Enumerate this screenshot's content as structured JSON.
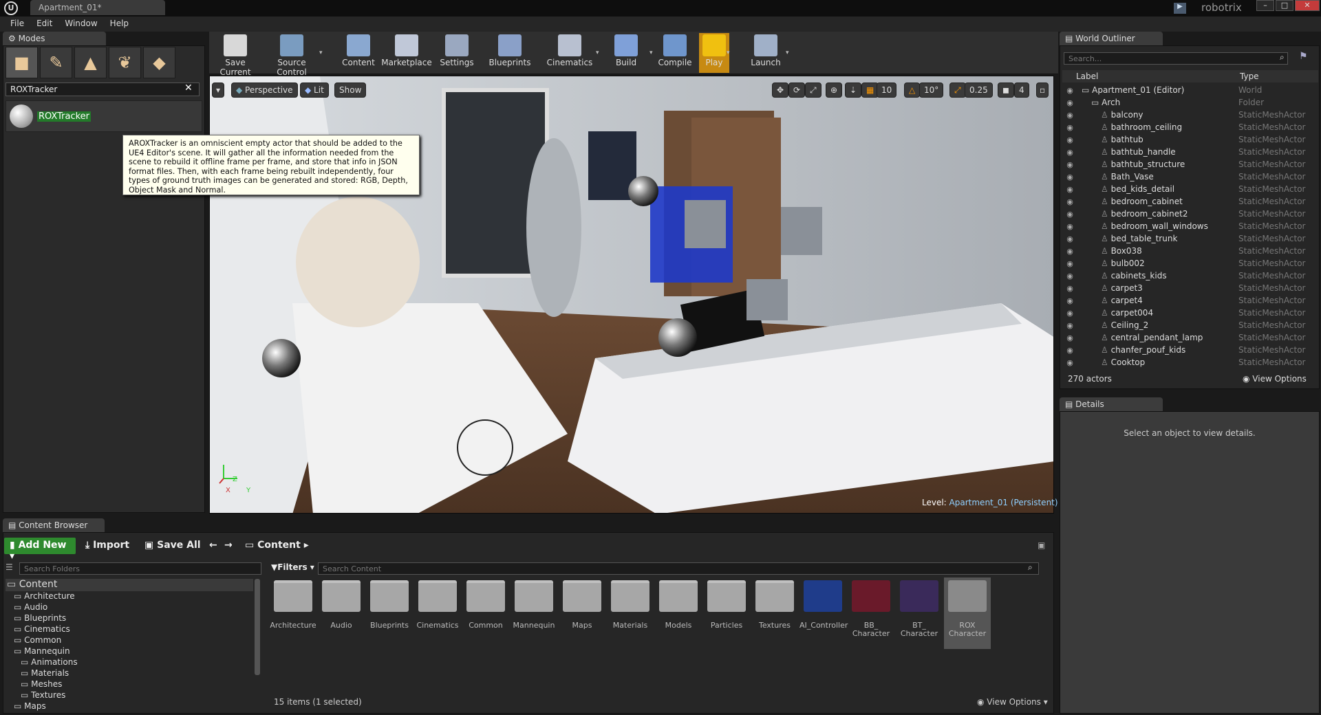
{
  "titlebar": {
    "doc_tab": "Apartment_01*",
    "project": "robotrix",
    "min": "–",
    "max": "□",
    "close": "✕"
  },
  "menu": [
    "File",
    "Edit",
    "Window",
    "Help"
  ],
  "modes": {
    "tab": "Modes",
    "search_value": "ROXTracker",
    "item_label": "ROXTracker",
    "tooltip": "AROXTracker is an omniscient empty actor that should be added to the UE4 Editor's scene. It will gather all the information needed from the scene to rebuild it offline frame per frame, and store that info in JSON format files. Then, with each frame being rebuilt independently, four types of ground truth images can be generated and stored: RGB, Depth, Object Mask and Normal."
  },
  "toolbar": [
    {
      "label": "Save Current",
      "icon": "save-icon",
      "color": "#d8d8d8"
    },
    {
      "label": "Source Control",
      "icon": "source-control-icon",
      "color": "#7a9cc0"
    },
    {
      "label": "Content",
      "icon": "content-icon",
      "color": "#8aa8d0"
    },
    {
      "label": "Marketplace",
      "icon": "marketplace-icon",
      "color": "#c0c8d8"
    },
    {
      "label": "Settings",
      "icon": "settings-icon",
      "color": "#9aa8c0"
    },
    {
      "label": "Blueprints",
      "icon": "blueprints-icon",
      "color": "#8aa0c8"
    },
    {
      "label": "Cinematics",
      "icon": "cinematics-icon",
      "color": "#b8c0d0"
    },
    {
      "label": "Build",
      "icon": "build-icon",
      "color": "#7fa0d8"
    },
    {
      "label": "Compile",
      "icon": "compile-icon",
      "color": "#6f96cc"
    },
    {
      "label": "Play",
      "icon": "play-icon",
      "color": "#f0c010"
    },
    {
      "label": "Launch",
      "icon": "launch-icon",
      "color": "#a0b0c8"
    }
  ],
  "viewport": {
    "perspective": "Perspective",
    "lit": "Lit",
    "show": "Show",
    "snap_grid": "10",
    "snap_rot": "10°",
    "snap_scale": "0.25",
    "cam_speed": "4",
    "level_label": "Level:",
    "level_name": "Apartment_01 (Persistent)",
    "axis_z": "Z",
    "axis_y": "Y",
    "axis_x": "X"
  },
  "outliner": {
    "tab": "World Outliner",
    "search_placeholder": "Search...",
    "col_label": "Label",
    "col_type": "Type",
    "rows": [
      {
        "label": "Apartment_01 (Editor)",
        "type": "World",
        "indent": 0
      },
      {
        "label": "Arch",
        "type": "Folder",
        "indent": 1
      },
      {
        "label": "balcony",
        "type": "StaticMeshActor",
        "indent": 2
      },
      {
        "label": "bathroom_ceiling",
        "type": "StaticMeshActor",
        "indent": 2
      },
      {
        "label": "bathtub",
        "type": "StaticMeshActor",
        "indent": 2
      },
      {
        "label": "bathtub_handle",
        "type": "StaticMeshActor",
        "indent": 2
      },
      {
        "label": "bathtub_structure",
        "type": "StaticMeshActor",
        "indent": 2
      },
      {
        "label": "Bath_Vase",
        "type": "StaticMeshActor",
        "indent": 2
      },
      {
        "label": "bed_kids_detail",
        "type": "StaticMeshActor",
        "indent": 2
      },
      {
        "label": "bedroom_cabinet",
        "type": "StaticMeshActor",
        "indent": 2
      },
      {
        "label": "bedroom_cabinet2",
        "type": "StaticMeshActor",
        "indent": 2
      },
      {
        "label": "bedroom_wall_windows",
        "type": "StaticMeshActor",
        "indent": 2
      },
      {
        "label": "bed_table_trunk",
        "type": "StaticMeshActor",
        "indent": 2
      },
      {
        "label": "Box038",
        "type": "StaticMeshActor",
        "indent": 2
      },
      {
        "label": "bulb002",
        "type": "StaticMeshActor",
        "indent": 2
      },
      {
        "label": "cabinets_kids",
        "type": "StaticMeshActor",
        "indent": 2
      },
      {
        "label": "carpet3",
        "type": "StaticMeshActor",
        "indent": 2
      },
      {
        "label": "carpet4",
        "type": "StaticMeshActor",
        "indent": 2
      },
      {
        "label": "carpet004",
        "type": "StaticMeshActor",
        "indent": 2
      },
      {
        "label": "Ceiling_2",
        "type": "StaticMeshActor",
        "indent": 2
      },
      {
        "label": "central_pendant_lamp",
        "type": "StaticMeshActor",
        "indent": 2
      },
      {
        "label": "chanfer_pouf_kids",
        "type": "StaticMeshActor",
        "indent": 2
      },
      {
        "label": "Cooktop",
        "type": "StaticMeshActor",
        "indent": 2
      }
    ],
    "count": "270 actors",
    "view_options": "View Options"
  },
  "details": {
    "tab": "Details",
    "empty_msg": "Select an object to view details."
  },
  "content_browser": {
    "tab": "Content Browser",
    "add_new": "Add New",
    "import": "Import",
    "save_all": "Save All",
    "path": "Content",
    "folder_search_placeholder": "Search Folders",
    "filters": "Filters",
    "content_search_placeholder": "Search Content",
    "tree": [
      {
        "label": "Content",
        "indent": 0,
        "root": true
      },
      {
        "label": "Architecture",
        "indent": 1
      },
      {
        "label": "Audio",
        "indent": 1
      },
      {
        "label": "Blueprints",
        "indent": 1
      },
      {
        "label": "Cinematics",
        "indent": 1
      },
      {
        "label": "Common",
        "indent": 1
      },
      {
        "label": "Mannequin",
        "indent": 1
      },
      {
        "label": "Animations",
        "indent": 2
      },
      {
        "label": "Materials",
        "indent": 2
      },
      {
        "label": "Meshes",
        "indent": 2
      },
      {
        "label": "Textures",
        "indent": 2
      },
      {
        "label": "Maps",
        "indent": 1
      }
    ],
    "assets": [
      {
        "label": "Architecture",
        "kind": "folder"
      },
      {
        "label": "Audio",
        "kind": "folder"
      },
      {
        "label": "Blueprints",
        "kind": "folder"
      },
      {
        "label": "Cinematics",
        "kind": "folder"
      },
      {
        "label": "Common",
        "kind": "folder"
      },
      {
        "label": "Mannequin",
        "kind": "folder"
      },
      {
        "label": "Maps",
        "kind": "folder"
      },
      {
        "label": "Materials",
        "kind": "folder"
      },
      {
        "label": "Models",
        "kind": "folder"
      },
      {
        "label": "Particles",
        "kind": "folder"
      },
      {
        "label": "Textures",
        "kind": "folder"
      },
      {
        "label": "AI_Controller",
        "kind": "asset",
        "color": "#1f3c8a"
      },
      {
        "label": "BB_\nCharacter",
        "kind": "asset",
        "color": "#6a1a2a"
      },
      {
        "label": "BT_\nCharacter",
        "kind": "asset",
        "color": "#3a2a5a"
      },
      {
        "label": "ROX\nCharacter",
        "kind": "asset",
        "color": "#8a8a8a",
        "selected": true
      }
    ],
    "count": "15 items (1 selected)",
    "view_options": "View Options"
  }
}
